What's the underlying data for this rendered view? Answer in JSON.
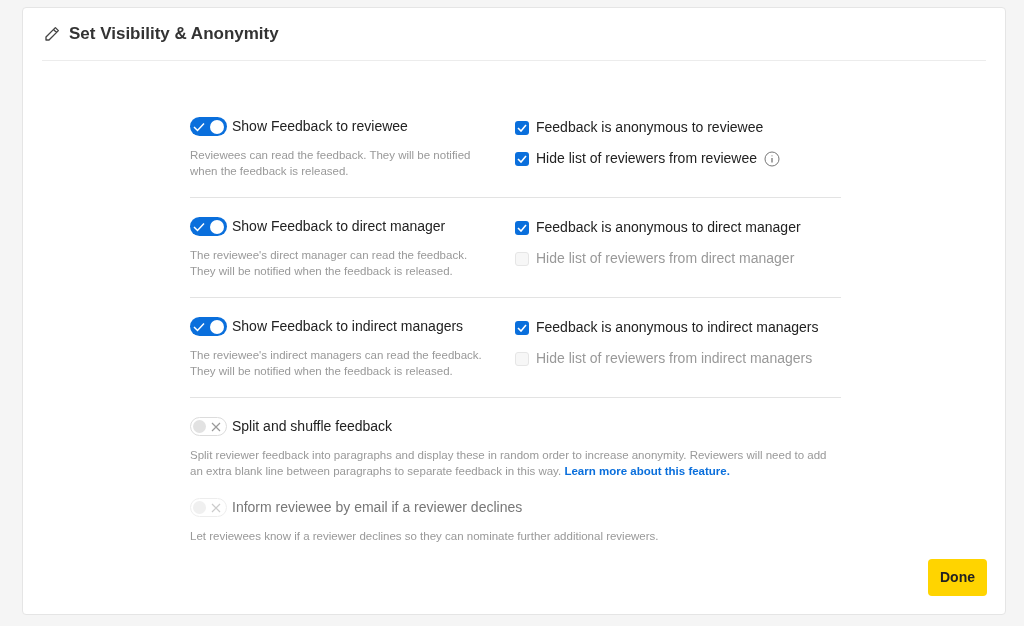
{
  "dialog": {
    "title": "Set Visibility & Anonymity"
  },
  "sections": [
    {
      "toggle": {
        "label": "Show Feedback to reviewee",
        "on": true,
        "disabled": false
      },
      "description": "Reviewees can read the feedback. They will be notified when the feedback is released.",
      "options": [
        {
          "label": "Feedback is anonymous to reviewee",
          "checked": true,
          "disabled": false,
          "info": false
        },
        {
          "label": "Hide list of reviewers from reviewee",
          "checked": true,
          "disabled": false,
          "info": true
        }
      ]
    },
    {
      "toggle": {
        "label": "Show Feedback to direct manager",
        "on": true,
        "disabled": false
      },
      "description": "The reviewee's direct manager can read the feedback. They will be notified when the feedback is released.",
      "options": [
        {
          "label": "Feedback is anonymous to direct manager",
          "checked": true,
          "disabled": false,
          "info": false
        },
        {
          "label": "Hide list of reviewers from direct manager",
          "checked": false,
          "disabled": true,
          "info": false
        }
      ]
    },
    {
      "toggle": {
        "label": "Show Feedback to indirect managers",
        "on": true,
        "disabled": false
      },
      "description": "The reviewee's indirect managers can read the feedback. They will be notified when the feedback is released.",
      "options": [
        {
          "label": "Feedback is anonymous to indirect managers",
          "checked": true,
          "disabled": false,
          "info": false
        },
        {
          "label": "Hide list of reviewers from indirect managers",
          "checked": false,
          "disabled": true,
          "info": false
        }
      ]
    }
  ],
  "extras": [
    {
      "toggle": {
        "label": "Split and shuffle feedback",
        "on": false,
        "disabled": false
      },
      "description": "Split reviewer feedback into paragraphs and display these in random order to increase anonymity. Reviewers will need to add an extra blank line between paragraphs to separate feedback in this way.",
      "link": "Learn more about this feature."
    },
    {
      "toggle": {
        "label": "Inform reviewee by email if a reviewer declines",
        "on": false,
        "disabled": true
      },
      "description": "Let reviewees know if a reviewer declines so they can nominate further additional reviewers."
    }
  ],
  "done_button": "Done"
}
